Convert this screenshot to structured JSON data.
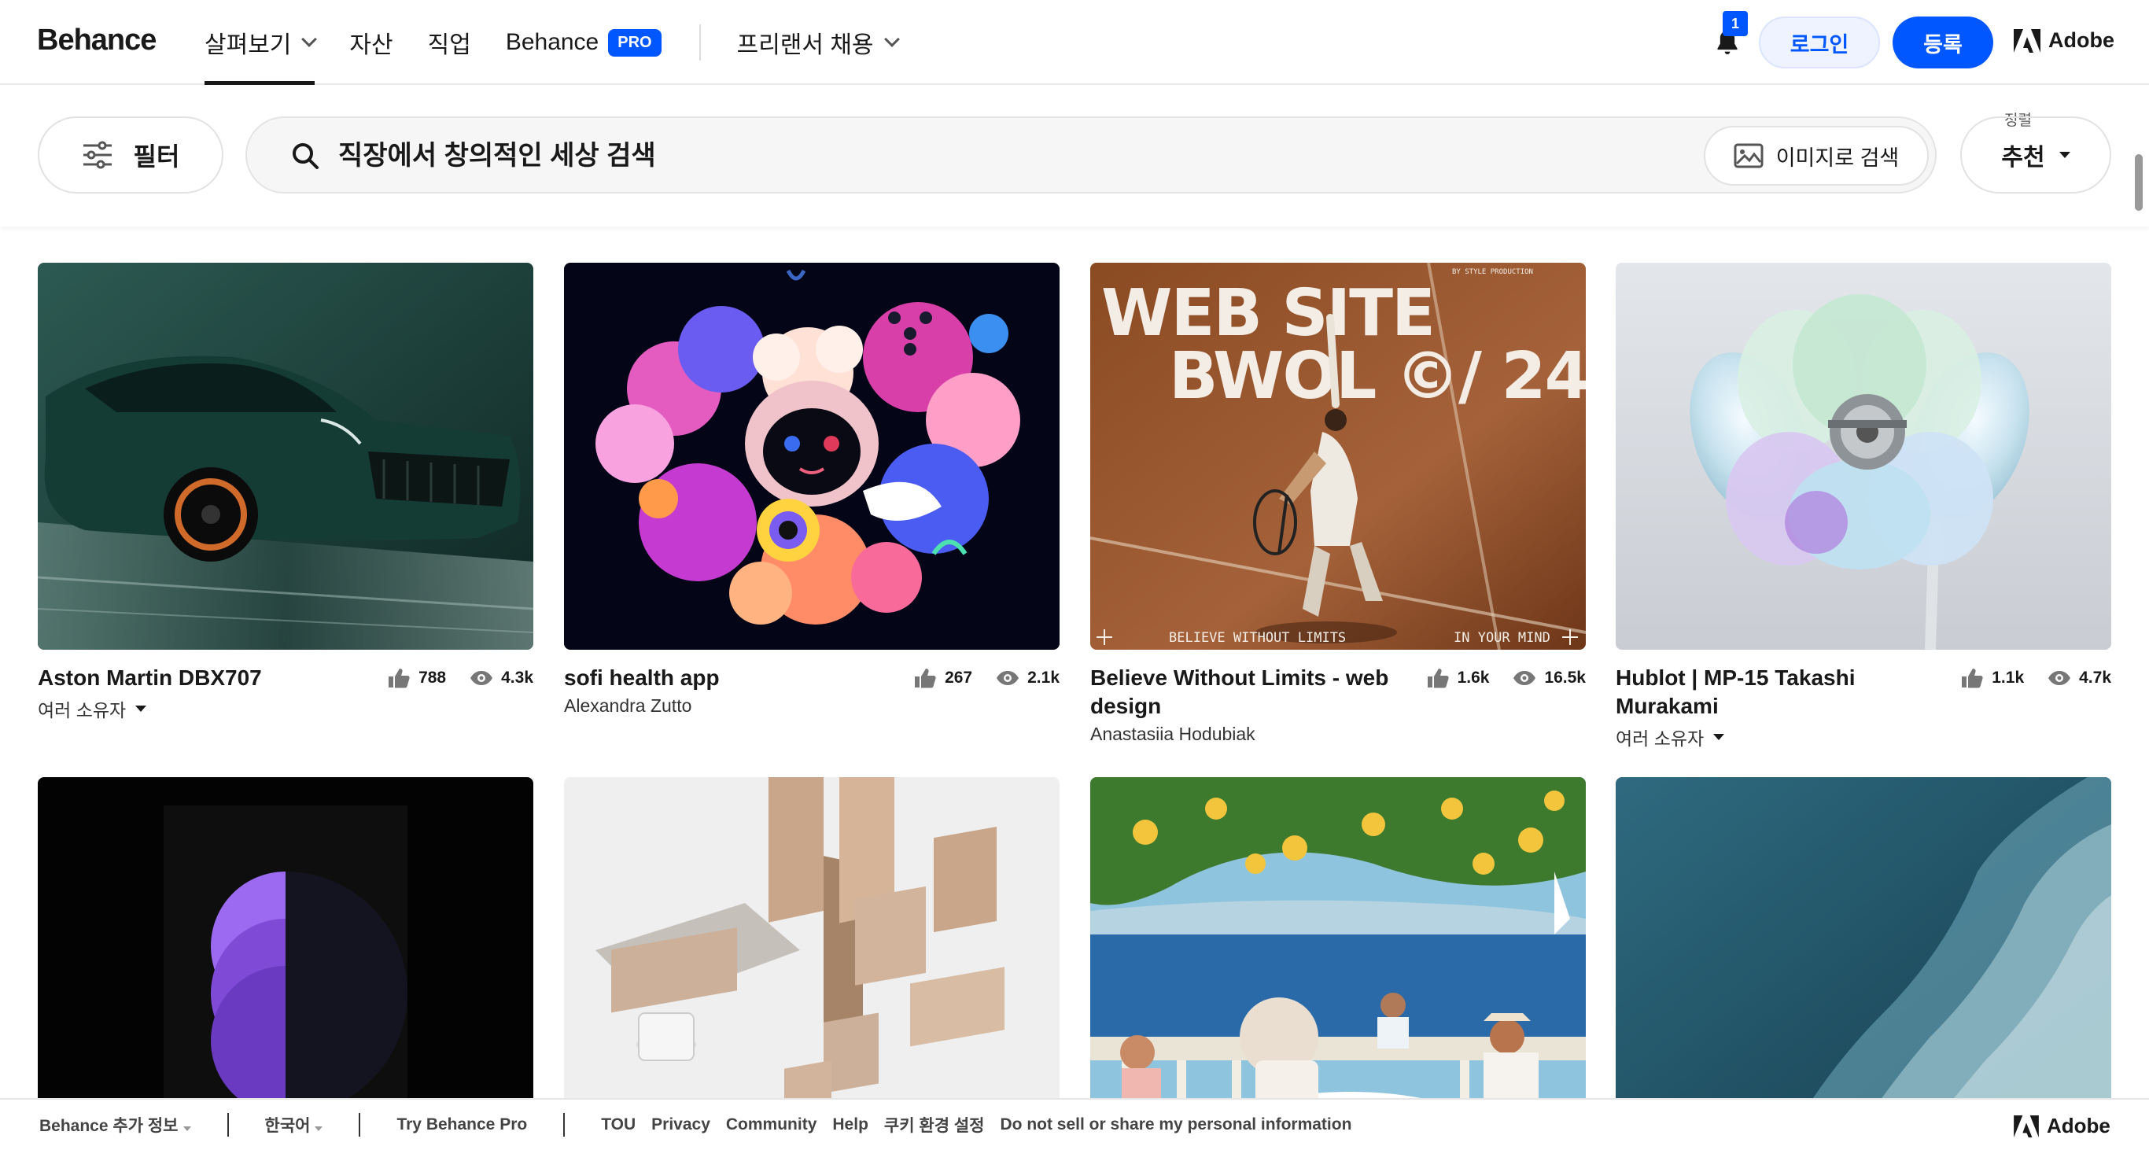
{
  "header": {
    "logo": "Behance",
    "nav": [
      {
        "label": "살펴보기",
        "has_dropdown": true,
        "active": true
      },
      {
        "label": "자산"
      },
      {
        "label": "직업"
      },
      {
        "label": "Behance",
        "badge": "PRO"
      },
      {
        "label": "프리랜서 채용",
        "has_dropdown": true
      }
    ],
    "notification_count": "1",
    "login_label": "로그인",
    "signup_label": "등록",
    "adobe_label": "Adobe"
  },
  "search": {
    "filter_label": "필터",
    "placeholder": "직장에서 창의적인 세상 검색",
    "image_search_label": "이미지로 검색",
    "sort_caption": "정렬",
    "sort_value": "추천"
  },
  "projects": [
    {
      "title": "Aston Martin DBX707",
      "owner": "여러 소유자",
      "owner_dropdown": true,
      "likes": "788",
      "views": "4.3k"
    },
    {
      "title": "sofi health app",
      "owner": "Alexandra Zutto",
      "likes": "267",
      "views": "2.1k"
    },
    {
      "title": "Believe Without Limits - web design",
      "owner": "Anastasiia Hodubiak",
      "likes": "1.6k",
      "views": "16.5k",
      "image_text": {
        "line1": "WEB SITE",
        "line2": "BWOL",
        "line3": "©/ 24",
        "bottom_left": "BELIEVE WITHOUT LIMITS",
        "bottom_right": "IN YOUR MIND",
        "top_right": "BY  STYLE PRODUCTION"
      }
    },
    {
      "title": "Hublot | MP-15 Takashi Murakami",
      "owner": "여러 소유자",
      "owner_dropdown": true,
      "likes": "1.1k",
      "views": "4.7k"
    },
    {
      "title": "",
      "owner": ""
    },
    {
      "title": "",
      "owner": ""
    },
    {
      "title": "",
      "owner": ""
    },
    {
      "title": "",
      "owner": ""
    }
  ],
  "footer": {
    "more_info": "Behance 추가 정보",
    "language": "한국어",
    "try_pro": "Try Behance Pro",
    "links": [
      "TOU",
      "Privacy",
      "Community",
      "Help",
      "쿠키 환경 설정",
      "Do not sell or share my personal information"
    ],
    "adobe_label": "Adobe"
  },
  "colors": {
    "accent": "#0057ff",
    "text": "#191919"
  }
}
